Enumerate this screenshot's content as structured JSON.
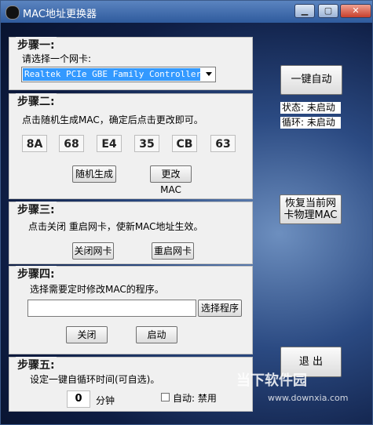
{
  "window": {
    "title": "MAC地址更换器",
    "min_icon": "minimize-icon",
    "max_icon": "maximize-icon",
    "close_icon": "close-icon"
  },
  "step1": {
    "title": "步骤一:",
    "prompt": "请选择一个网卡:",
    "adapter_selected": "Realtek PCIe GBE Family Controller"
  },
  "step2": {
    "title": "步骤二:",
    "prompt": "点击随机生成MAC，确定后点击更改即可。",
    "mac": [
      "8A",
      "68",
      "E4",
      "35",
      "CB",
      "63"
    ],
    "random_button": "随机生成",
    "change_button": "更改 MAC"
  },
  "step3": {
    "title": "步骤三:",
    "prompt": "点击关闭 重启网卡，使新MAC地址生效。",
    "disable_button": "关闭网卡",
    "restart_button": "重启网卡"
  },
  "step4": {
    "title": "步骤四:",
    "prompt": "选择需要定时修改MAC的程序。",
    "program_path": "",
    "choose_button": "选择程序",
    "close_button": "关闭",
    "start_button": "启动"
  },
  "step5": {
    "title": "步骤五:",
    "prompt": "设定一键自循环时间(可自选)。",
    "minutes": "0",
    "minutes_unit": "分钟",
    "auto_label": "自动: 禁用"
  },
  "right": {
    "one_click_button": "一键自动",
    "status_text": "状态: 未启动",
    "loop_text": "循环: 未启动",
    "restore_button_line1": "恢复当前网",
    "restore_button_line2": "卡物理MAC",
    "exit_button": "退 出"
  },
  "watermark": {
    "brand": "当下软件园",
    "url": "www.downxia.com"
  },
  "colors": {
    "titlebar": "#2f5b9d",
    "panel": "#f0f0f0",
    "selection": "#3399ff",
    "close_button": "#c8402c"
  }
}
